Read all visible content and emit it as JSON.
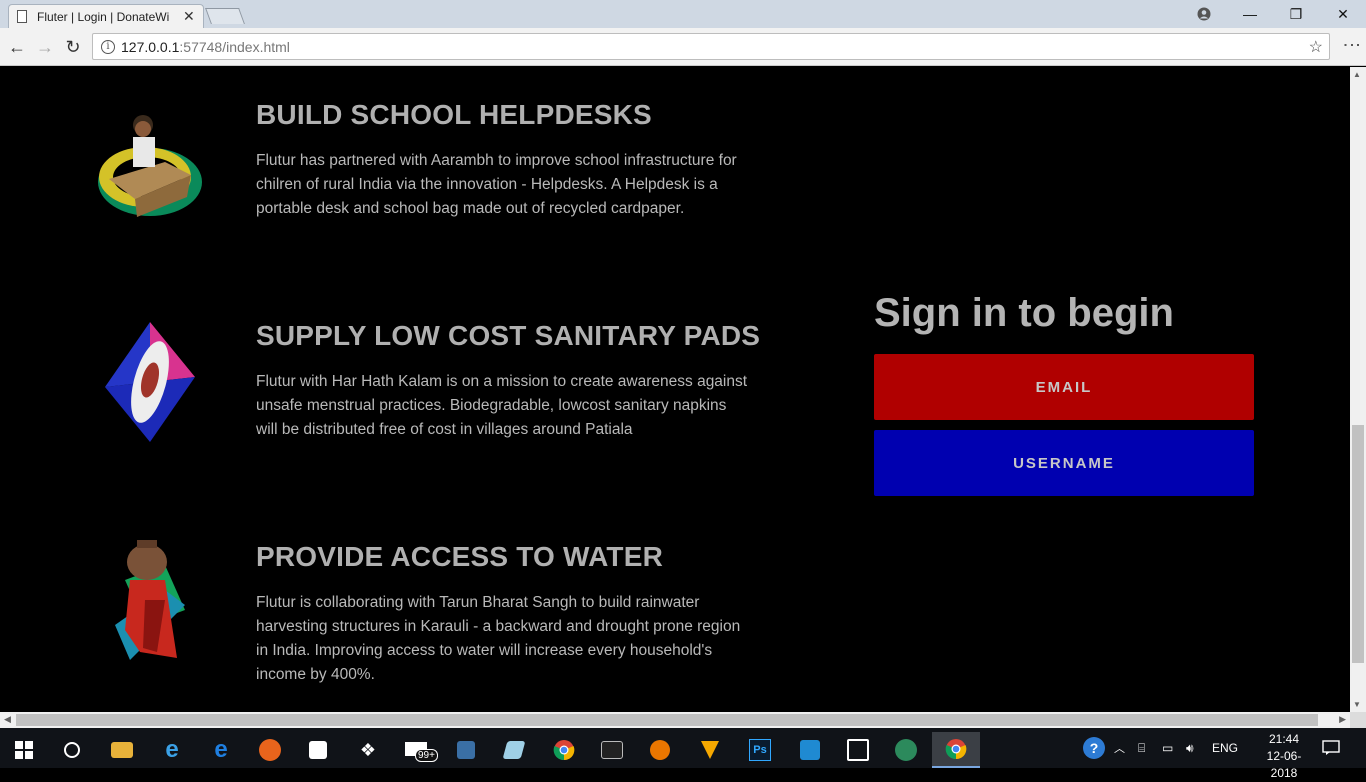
{
  "browser": {
    "tab_title": "Fluter | Login | DonateWi",
    "url_host": "127.0.0.1",
    "url_rest": ":57748/index.html"
  },
  "causes": [
    {
      "title": "BUILD SCHOOL HELPDESKS",
      "description": "Flutur has partnered with Aarambh to improve school infrastructure for chilren of rural India via the innovation - Helpdesks. A Helpdesk is a portable desk and school bag made out of recycled cardpaper."
    },
    {
      "title": "SUPPLY LOW COST SANITARY PADS",
      "description": "Flutur with Har Hath Kalam is on a mission to create awareness against unsafe menstrual practices. Biodegradable, lowcost sanitary napkins will be distributed free of cost in villages around Patiala"
    },
    {
      "title": "PROVIDE ACCESS TO WATER",
      "description": "Flutur is collaborating with Tarun Bharat Sangh to build rainwater harvesting structures in Karauli - a backward and drought prone region in India. Improving access to water will increase every household's income by 400%."
    }
  ],
  "signin": {
    "title": "Sign in to begin",
    "email_label": "EMAIL",
    "username_label": "USERNAME"
  },
  "colors": {
    "email_button": "#b00000",
    "username_button": "#0000b0",
    "page_background": "#000000"
  },
  "taskbar": {
    "badge": "99+",
    "language": "ENG",
    "time": "21:44",
    "date": "12-06-2018"
  }
}
